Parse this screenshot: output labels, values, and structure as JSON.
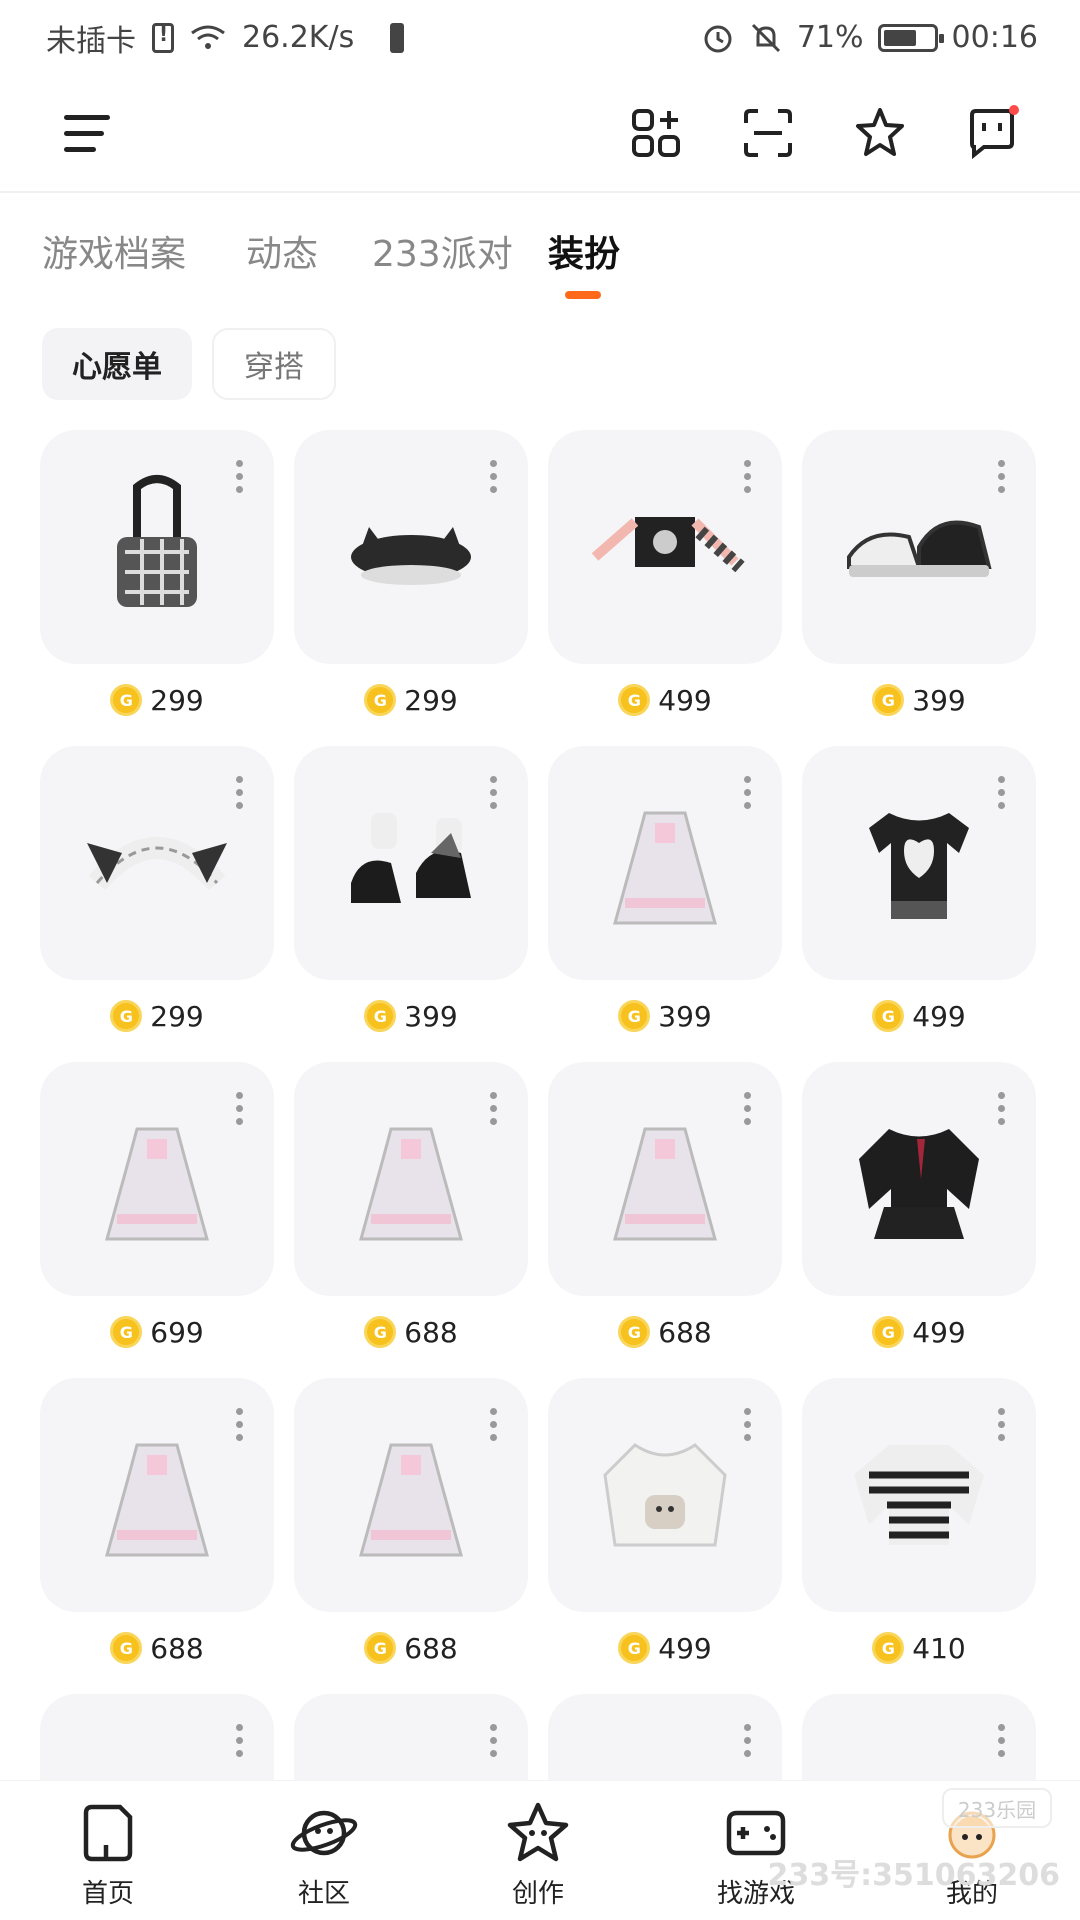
{
  "status_bar": {
    "carrier": "未插卡",
    "speed": "26.2K/s",
    "battery_percent": "71%",
    "time": "00:16"
  },
  "tabs": [
    {
      "label": "游戏档案"
    },
    {
      "label": "动态"
    },
    {
      "label": "233派对"
    },
    {
      "label": "装扮"
    }
  ],
  "active_tab": "装扮",
  "chips": [
    {
      "label": "心愿单"
    },
    {
      "label": "穿搭"
    }
  ],
  "items": [
    {
      "name": "plaid-shoulder-bag",
      "price": "299",
      "icon": "bag-icon"
    },
    {
      "name": "black-cat-ear-beret",
      "price": "299",
      "icon": "beret-icon"
    },
    {
      "name": "punk-crop-top",
      "price": "499",
      "icon": "top-icon"
    },
    {
      "name": "black-white-sneakers",
      "price": "399",
      "icon": "sneaker-icon"
    },
    {
      "name": "maid-cat-ear-headband",
      "price": "299",
      "icon": "headband-icon"
    },
    {
      "name": "bow-mary-jane-shoes",
      "price": "399",
      "icon": "shoes-icon"
    },
    {
      "name": "plaid-skirt-outfit",
      "price": "399",
      "icon": "dress-icon"
    },
    {
      "name": "heart-print-tshirt-set",
      "price": "499",
      "icon": "tshirt-icon"
    },
    {
      "name": "pink-lolita-dress",
      "price": "699",
      "icon": "dress-icon"
    },
    {
      "name": "pink-winged-dress",
      "price": "688",
      "icon": "dress-icon"
    },
    {
      "name": "black-bat-wing-dress",
      "price": "688",
      "icon": "dress-icon"
    },
    {
      "name": "sailor-uniform-set",
      "price": "499",
      "icon": "uniform-icon"
    },
    {
      "name": "pink-bunny-dress",
      "price": "688",
      "icon": "dress-icon"
    },
    {
      "name": "black-bunny-dress",
      "price": "688",
      "icon": "dress-icon"
    },
    {
      "name": "bear-hoodie",
      "price": "499",
      "icon": "hoodie-icon"
    },
    {
      "name": "striped-sweater",
      "price": "410",
      "icon": "sweater-icon"
    },
    {
      "name": "item-row5-1",
      "price": "",
      "icon": "item-icon"
    },
    {
      "name": "item-row5-2",
      "price": "",
      "icon": "item-icon"
    },
    {
      "name": "item-row5-3",
      "price": "",
      "icon": "item-icon"
    },
    {
      "name": "item-row5-4",
      "price": "",
      "icon": "item-icon"
    }
  ],
  "bottom_nav": [
    {
      "label": "首页",
      "icon": "home-icon"
    },
    {
      "label": "社区",
      "icon": "planet-icon"
    },
    {
      "label": "创作",
      "icon": "star-icon"
    },
    {
      "label": "找游戏",
      "icon": "gamepad-icon"
    },
    {
      "label": "我的",
      "icon": "avatar-icon"
    }
  ],
  "watermark": "233号:351063206",
  "watermark_logo": "233乐园",
  "colors": {
    "accent": "#ff6a1a",
    "coin": "#f7c21d",
    "card_bg": "#f5f5f8"
  }
}
